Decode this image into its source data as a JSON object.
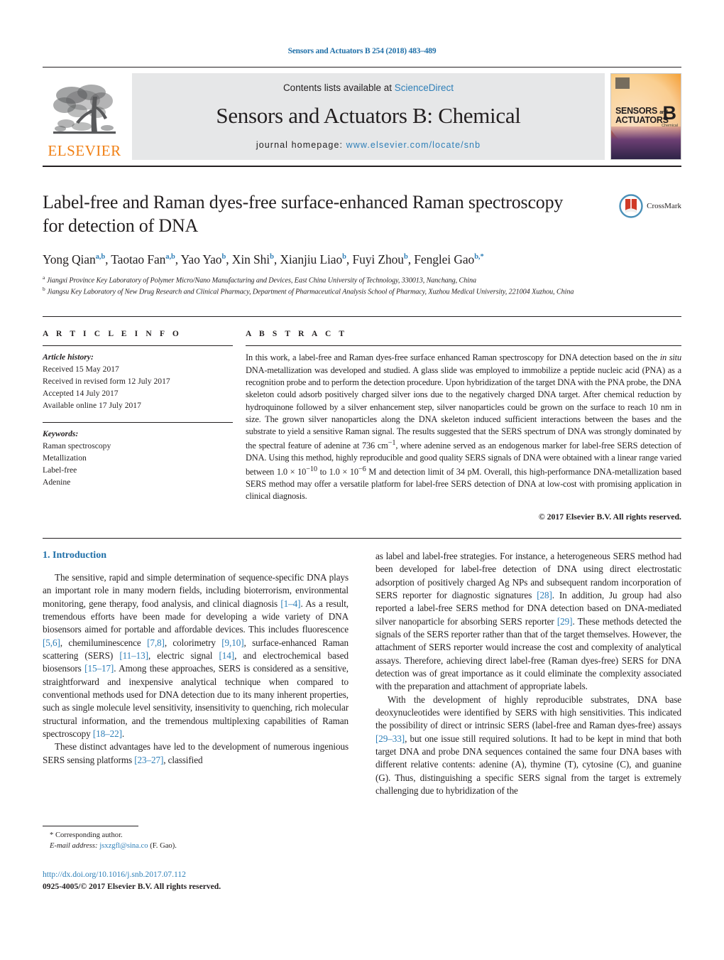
{
  "running_head": "Sensors and Actuators B 254 (2018) 483–489",
  "masthead": {
    "publisher_logo_text": "ELSEVIER",
    "contents_prefix": "Contents lists available at ",
    "contents_link": "ScienceDirect",
    "journal_title": "Sensors and Actuators B: Chemical",
    "homepage_prefix": "journal homepage: ",
    "homepage_link": "www.elsevier.com/locate/snb",
    "cover": {
      "line1": "SENSORS",
      "line1_small": "and",
      "line2": "ACTUATORS",
      "letter": "B",
      "letter_sub": "Chemical"
    }
  },
  "article": {
    "title": "Label-free and Raman dyes-free surface-enhanced Raman spectroscopy for detection of DNA",
    "crossmark_label": "CrossMark",
    "authors": [
      {
        "name": "Yong Qian",
        "sup": "a,b",
        "sep": ", "
      },
      {
        "name": "Taotao Fan",
        "sup": "a,b",
        "sep": ", "
      },
      {
        "name": "Yao Yao",
        "sup": "b",
        "sep": ", "
      },
      {
        "name": "Xin Shi",
        "sup": "b",
        "sep": ", "
      },
      {
        "name": "Xianjiu Liao",
        "sup": "b",
        "sep": ", "
      },
      {
        "name": "Fuyi Zhou",
        "sup": "b",
        "sep": ", "
      },
      {
        "name": "Fenglei Gao",
        "sup": "b,*",
        "sep": ""
      }
    ],
    "affiliations": [
      {
        "mark": "a",
        "text": "Jiangxi Province Key Laboratory of Polymer Micro/Nano Manufacturing and Devices, East China University of Technology, 330013, Nanchang, China"
      },
      {
        "mark": "b",
        "text": "Jiangsu Key Laboratory of New Drug Research and Clinical Pharmacy, Department of Pharmaceutical Analysis School of Pharmacy, Xuzhou Medical University, 221004 Xuzhou, China"
      }
    ]
  },
  "article_info": {
    "heading": "A R T I C L E  I N F O",
    "history_label": "Article history:",
    "history": [
      "Received 15 May 2017",
      "Received in revised form 12 July 2017",
      "Accepted 14 July 2017",
      "Available online 17 July 2017"
    ],
    "keywords_label": "Keywords:",
    "keywords": [
      "Raman spectroscopy",
      "Metallization",
      "Label-free",
      "Adenine"
    ]
  },
  "abstract": {
    "heading": "A B S T R A C T",
    "part1": "In this work, a label-free and Raman dyes-free surface enhanced Raman spectroscopy for DNA detection based on the ",
    "italic1": "in situ",
    "part2": " DNA-metallization was developed and studied. A glass slide was employed to immobilize a peptide nucleic acid (PNA) as a recognition probe and to perform the detection procedure. Upon hybridization of the target DNA with the PNA probe, the DNA skeleton could adsorb positively charged silver ions due to the negatively charged DNA target. After chemical reduction by hydroquinone followed by a silver enhancement step, silver nanoparticles could be grown on the surface to reach 10 nm in size. The grown silver nanoparticles along the DNA skeleton induced sufficient interactions between the bases and the substrate to yield a sensitive Raman signal. The results suggested that the SERS spectrum of DNA was strongly dominated by the spectral feature of adenine at 736 cm",
    "sup1": "−1",
    "part3": ", where adenine served as an endogenous marker for label-free SERS detection of DNA. Using this method, highly reproducible and good quality SERS signals of DNA were obtained with a linear range varied between 1.0 × 10",
    "sup2": "−10",
    "part4": " to 1.0 × 10",
    "sup3": "−6",
    "part5": " M and detection limit of 34 pM. Overall, this high-performance DNA-metallization based SERS method may offer a versatile platform for label-free SERS detection of DNA at low-cost with promising application in clinical diagnosis.",
    "copyright": "© 2017 Elsevier B.V. All rights reserved."
  },
  "introduction": {
    "section_title": "1. Introduction",
    "left_paragraphs": [
      {
        "runs": [
          {
            "t": "The sensitive, rapid and simple determination of sequence-specific DNA plays an important role in many modern fields, including bioterrorism, environmental monitoring, gene therapy, food analysis, and clinical diagnosis "
          },
          {
            "t": "[1–4]",
            "link": true
          },
          {
            "t": ". As a result, tremendous efforts have been made for developing a wide variety of DNA biosensors aimed for portable and affordable devices. This includes fluorescence "
          },
          {
            "t": "[5,6]",
            "link": true
          },
          {
            "t": ", chemiluminescence "
          },
          {
            "t": "[7,8]",
            "link": true
          },
          {
            "t": ", colorimetry "
          },
          {
            "t": "[9,10]",
            "link": true
          },
          {
            "t": ", surface-enhanced Raman scattering (SERS) "
          },
          {
            "t": "[11–13]",
            "link": true
          },
          {
            "t": ", electric signal "
          },
          {
            "t": "[14]",
            "link": true
          },
          {
            "t": ", and electrochemical based biosensors "
          },
          {
            "t": "[15–17]",
            "link": true
          },
          {
            "t": ". Among these approaches, SERS is considered as a sensitive, straightforward and inexpensive analytical technique when compared to conventional methods used for DNA detection due to its many inherent properties, such as single molecule level sensitivity, insensitivity to quenching, rich molecular structural information, and the tremendous multiplexing capabilities of Raman spectroscopy "
          },
          {
            "t": "[18–22]",
            "link": true
          },
          {
            "t": "."
          }
        ]
      },
      {
        "runs": [
          {
            "t": "These distinct advantages have led to the development of numerous ingenious SERS sensing platforms "
          },
          {
            "t": "[23–27]",
            "link": true
          },
          {
            "t": ", classified"
          }
        ]
      }
    ],
    "right_paragraphs": [
      {
        "runs": [
          {
            "t": "as label and label-free strategies. For instance, a heterogeneous SERS method had been developed for label-free detection of DNA using direct electrostatic adsorption of positively charged Ag NPs and subsequent random incorporation of SERS reporter for diagnostic signatures "
          },
          {
            "t": "[28]",
            "link": true
          },
          {
            "t": ". In addition, Ju group had also reported a label-free SERS method for DNA detection based on DNA-mediated silver nanoparticle for absorbing SERS reporter "
          },
          {
            "t": "[29]",
            "link": true
          },
          {
            "t": ". These methods detected the signals of the SERS reporter rather than that of the target themselves. However, the attachment of SERS reporter would increase the cost and complexity of analytical assays. Therefore, achieving direct label-free (Raman dyes-free) SERS for DNA detection was of great importance as it could eliminate the complexity associated with the preparation and attachment of appropriate labels."
          }
        ]
      },
      {
        "runs": [
          {
            "t": "With the development of highly reproducible substrates, DNA base deoxynucleotides were identified by SERS with high sensitivities. This indicated the possibility of direct or intrinsic SERS (label-free and Raman dyes-free) assays "
          },
          {
            "t": "[29–33]",
            "link": true
          },
          {
            "t": ", but one issue still required solutions. It had to be kept in mind that both target DNA and probe DNA sequences contained the same four DNA bases with different relative contents: adenine (A), thymine (T), cytosine (C), and guanine (G). Thus, distinguishing a specific SERS signal from the target is extremely challenging due to hybridization of the"
          }
        ]
      }
    ]
  },
  "footnote": {
    "corresponding": "* Corresponding author.",
    "email_label": "E-mail address:",
    "email": "jsxzgfl@sina.co",
    "email_suffix": "(F. Gao)."
  },
  "footer": {
    "doi": "http://dx.doi.org/10.1016/j.snb.2017.07.112",
    "issn_line": "0925-4005/© 2017 Elsevier B.V. All rights reserved."
  },
  "colors": {
    "link": "#2e7fb8",
    "heading": "#1f6fa8",
    "elsevier_orange": "#f07f13",
    "band_grey": "#e6e7e8",
    "text": "#231f20"
  }
}
